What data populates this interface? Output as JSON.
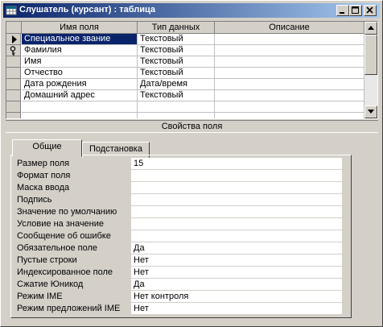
{
  "window": {
    "title": "Слушатель (курсант) : таблица",
    "buttons": [
      "minimize",
      "maximize",
      "close"
    ]
  },
  "grid": {
    "columns": [
      "Имя поля",
      "Тип данных",
      "Описание"
    ],
    "rows": [
      {
        "name": "Специальное звание",
        "type": "Текстовый",
        "description": "",
        "marker": "current-row-arrow",
        "selected": true
      },
      {
        "name": "Фамилия",
        "type": "Текстовый",
        "description": "",
        "marker": "primary-key"
      },
      {
        "name": "Имя",
        "type": "Текстовый",
        "description": ""
      },
      {
        "name": "Отчество",
        "type": "Текстовый",
        "description": ""
      },
      {
        "name": "Дата рождения",
        "type": "Дата/время",
        "description": ""
      },
      {
        "name": "Домашний адрес",
        "type": "Текстовый",
        "description": ""
      },
      {
        "name": "",
        "type": "",
        "description": ""
      },
      {
        "name": "",
        "type": "",
        "description": ""
      }
    ]
  },
  "field_properties": {
    "header": "Свойства поля",
    "tabs": [
      "Общие",
      "Подстановка"
    ],
    "active_tab": 0,
    "properties": [
      {
        "label": "Размер поля",
        "value": "15"
      },
      {
        "label": "Формат поля",
        "value": ""
      },
      {
        "label": "Маска ввода",
        "value": ""
      },
      {
        "label": "Подпись",
        "value": ""
      },
      {
        "label": "Значение по умолчанию",
        "value": ""
      },
      {
        "label": "Условие на значение",
        "value": ""
      },
      {
        "label": "Сообщение об ошибке",
        "value": ""
      },
      {
        "label": "Обязательное поле",
        "value": "Да"
      },
      {
        "label": "Пустые строки",
        "value": "Нет"
      },
      {
        "label": "Индексированное поле",
        "value": "Нет"
      },
      {
        "label": "Сжатие Юникод",
        "value": "Да"
      },
      {
        "label": "Режим IME",
        "value": "Нет контроля"
      },
      {
        "label": "Режим предложений IME",
        "value": "Нет"
      }
    ]
  },
  "colors": {
    "title_start": "#0a246a",
    "title_end": "#a6caf0",
    "selection": "#0a246a",
    "face": "#d4d0c8"
  }
}
